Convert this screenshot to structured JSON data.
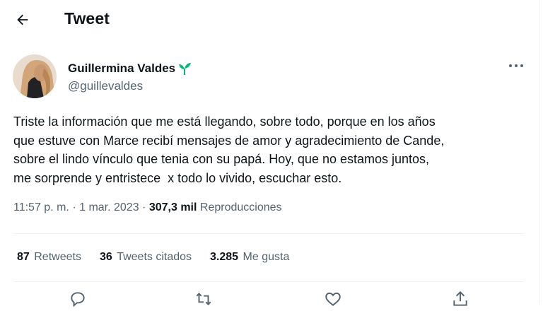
{
  "header": {
    "title": "Tweet",
    "back_icon": "arrow-left-icon"
  },
  "author": {
    "display_name": "Guillermina Valdes",
    "badge_icon": "sprout-icon",
    "handle": "@guillevaldes"
  },
  "tweet": {
    "lines": [
      "Triste la información que me está llegando, sobre todo, porque en los años",
      "que estuve con Marce recibí mensajes de amor y agradecimiento de Cande,",
      "sobre el lindo vínculo que tenia con su papá. Hoy, que no estamos juntos,",
      "me sorprende y entristece  x todo lo vivido, escuchar esto."
    ],
    "time": "11:57 p. m.",
    "separator": "·",
    "date": "1 mar. 2023",
    "views_count": "307,3 mil",
    "views_label": "Reproducciones"
  },
  "stats": {
    "retweets": {
      "count": "87",
      "label": "Retweets"
    },
    "quotes": {
      "count": "36",
      "label": "Tweets citados"
    },
    "likes": {
      "count": "3.285",
      "label": "Me gusta"
    }
  },
  "actions": [
    "reply-icon",
    "retweet-icon",
    "like-icon",
    "share-icon"
  ],
  "colors": {
    "text": "#0f1419",
    "secondary": "#536471",
    "divider": "#eff3f4",
    "badge": "#00ba7c"
  }
}
